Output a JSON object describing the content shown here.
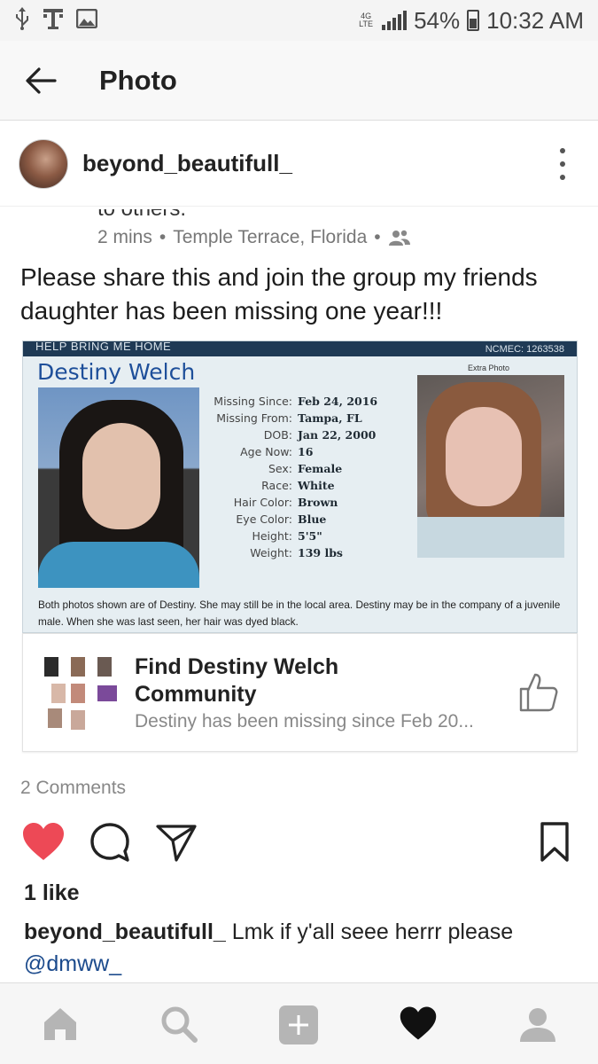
{
  "status_bar": {
    "network": "4G LTE",
    "battery": "54%",
    "time": "10:32 AM"
  },
  "header": {
    "title": "Photo"
  },
  "post": {
    "username": "beyond_beautifull_",
    "cut_text": "to others.",
    "time_ago": "2 mins",
    "location": "Temple Terrace, Florida",
    "separator": "•",
    "text": "Please share this and join the group my friends daughter has been missing one year!!!",
    "poster": {
      "banner_left": "HELP BRING ME HOME",
      "banner_right": "NCMEC: 1263538",
      "name": "Destiny Welch",
      "extra_label": "Extra Photo",
      "stats": [
        {
          "k": "Missing Since:",
          "v": "Feb 24, 2016"
        },
        {
          "k": "Missing From:",
          "v": "Tampa, FL"
        },
        {
          "k": "DOB:",
          "v": "Jan 22, 2000"
        },
        {
          "k": "Age Now:",
          "v": "16"
        },
        {
          "k": "Sex:",
          "v": "Female"
        },
        {
          "k": "Race:",
          "v": "White"
        },
        {
          "k": "Hair Color:",
          "v": "Brown"
        },
        {
          "k": "Eye Color:",
          "v": "Blue"
        },
        {
          "k": "Height:",
          "v": "5'5\""
        },
        {
          "k": "Weight:",
          "v": "139 lbs"
        }
      ],
      "description": "Both photos shown are of Destiny. She may still be in the local area. Destiny may be in the company of a juvenile male. When she was last seen, her hair was dyed black."
    },
    "link_card": {
      "title": "Find Destiny Welch Community",
      "subtitle": "Destiny has been missing since Feb 20..."
    },
    "comments": "2 Comments"
  },
  "engagement": {
    "likes": "1 like",
    "caption_user": "beyond_beautifull_",
    "caption_text": "Lmk if y'all seee herrr please",
    "mention": "@dmww_"
  },
  "colors": {
    "heart": "#ed4956",
    "poster_blue": "#1e4f9a",
    "mention": "#1b4a8c"
  },
  "icons": {
    "status_left": [
      "usb-icon",
      "t-mobile-icon",
      "image-icon"
    ],
    "actions": [
      "heart-icon",
      "comment-icon",
      "share-icon",
      "bookmark-icon"
    ],
    "nav": [
      "home-icon",
      "search-icon",
      "add-icon",
      "activity-icon",
      "profile-icon"
    ]
  }
}
